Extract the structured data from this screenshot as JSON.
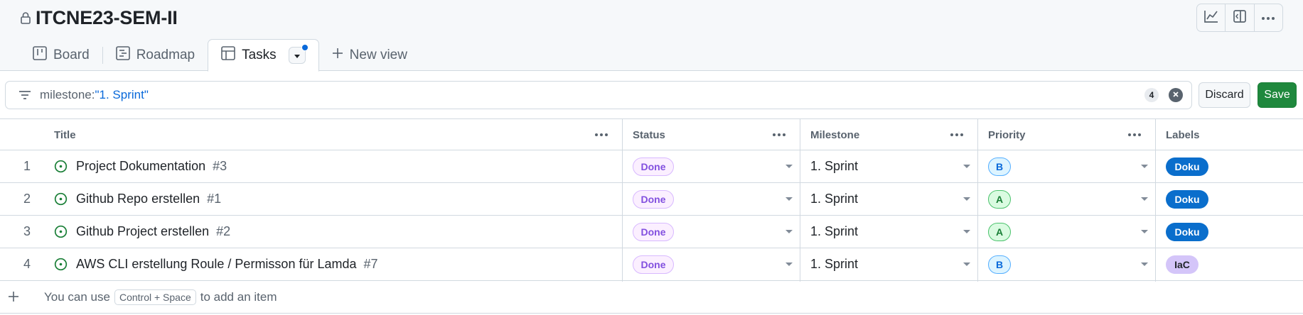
{
  "project": {
    "title": "ITCNE23-SEM-II",
    "lock_icon": "lock-icon"
  },
  "header_actions": [
    {
      "name": "insights-icon"
    },
    {
      "name": "side-panel-icon"
    },
    {
      "name": "kebab-horizontal-icon"
    }
  ],
  "tabs": [
    {
      "label": "Board",
      "icon": "board-icon"
    },
    {
      "label": "Roadmap",
      "icon": "roadmap-icon"
    },
    {
      "label": "Tasks",
      "icon": "table-icon",
      "active": true
    },
    {
      "label": "New view",
      "icon": "plus-icon"
    }
  ],
  "filter": {
    "key": "milestone:",
    "value": "\"1. Sprint\"",
    "count": "4",
    "discard_label": "Discard",
    "save_label": "Save"
  },
  "columns": {
    "title": "Title",
    "status": "Status",
    "milestone": "Milestone",
    "priority": "Priority",
    "labels": "Labels"
  },
  "rows": [
    {
      "n": "1",
      "title": "Project Dokumentation",
      "issue": "#3",
      "status": "Done",
      "milestone": "1. Sprint",
      "priority": "B",
      "label": "Doku"
    },
    {
      "n": "2",
      "title": "Github Repo erstellen",
      "issue": "#1",
      "status": "Done",
      "milestone": "1. Sprint",
      "priority": "A",
      "label": "Doku"
    },
    {
      "n": "3",
      "title": "Github Project erstellen",
      "issue": "#2",
      "status": "Done",
      "milestone": "1. Sprint",
      "priority": "A",
      "label": "Doku"
    },
    {
      "n": "4",
      "title": "AWS CLI erstellung Roule / Permisson für Lamda",
      "issue": "#7",
      "status": "Done",
      "milestone": "1. Sprint",
      "priority": "B",
      "label": "IaC"
    }
  ],
  "add_item": {
    "prefix": "You can use",
    "shortcut": "Control + Space",
    "suffix": "to add an item"
  },
  "colors": {
    "accent": "#0969da",
    "save_green": "#1f883d",
    "done_purple": "#8250df",
    "open_issue_green": "#1a7f37",
    "label_doku": "#0a6ecc",
    "label_iac": "#d4c5f9"
  }
}
